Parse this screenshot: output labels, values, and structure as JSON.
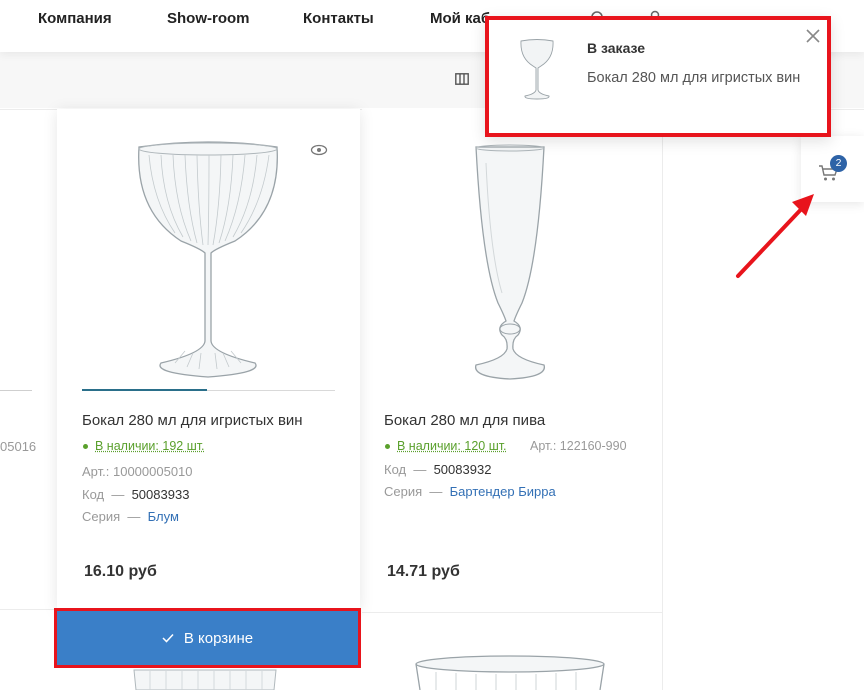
{
  "nav": {
    "items": [
      "Компания",
      "Show-room",
      "Контакты",
      "Мой каб"
    ]
  },
  "notification": {
    "title": "В заказе",
    "text": "Бокал 280 мл для игристых вин"
  },
  "float_cart": {
    "count": "2"
  },
  "left_partial": {
    "code": "05016"
  },
  "products": [
    {
      "title": "Бокал 280 мл для игристых вин",
      "stock": "В наличии: 192 шт.",
      "article_label": "Арт.:",
      "article": "10000005010",
      "code_label": "Код",
      "code": "50083933",
      "series_label": "Серия",
      "series": "Блум",
      "price": "16.10 руб",
      "cart_label": "В корзине"
    },
    {
      "title": "Бокал 280 мл для пива",
      "stock": "В наличии: 120 шт.",
      "article_label": "Арт.:",
      "article": "122160-990",
      "code_label": "Код",
      "code": "50083932",
      "series_label": "Серия",
      "series": "Бартендер Бирра",
      "price": "14.71 руб"
    }
  ],
  "dash": "—",
  "colors": {
    "accent": "#3a7fc8",
    "highlight": "#e8141c",
    "stock": "#5aa02c",
    "link": "#3370b5",
    "badge": "#2e63a7"
  }
}
